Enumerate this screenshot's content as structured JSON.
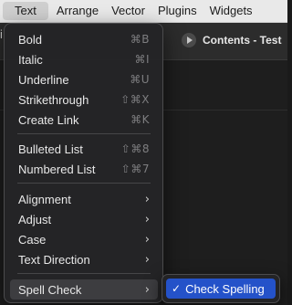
{
  "menubar": {
    "items": [
      {
        "label": "Text",
        "active": true
      },
      {
        "label": "Arrange"
      },
      {
        "label": "Vector"
      },
      {
        "label": "Plugins"
      },
      {
        "label": "Widgets"
      }
    ]
  },
  "background": {
    "left_cut_text": "i",
    "title": "Contents - Test",
    "play_icon": "play-icon"
  },
  "menu": {
    "items": [
      {
        "label": "Bold",
        "shortcut": "⌘B"
      },
      {
        "label": "Italic",
        "shortcut": "⌘I"
      },
      {
        "label": "Underline",
        "shortcut": "⌘U"
      },
      {
        "label": "Strikethrough",
        "shortcut": "⇧⌘X"
      },
      {
        "label": "Create Link",
        "shortcut": "⌘K"
      },
      {
        "label": "Bulleted List",
        "shortcut": "⇧⌘8"
      },
      {
        "label": "Numbered List",
        "shortcut": "⇧⌘7"
      },
      {
        "label": "Alignment",
        "submenu_icon": "chevron-right-icon"
      },
      {
        "label": "Adjust",
        "submenu_icon": "chevron-right-icon"
      },
      {
        "label": "Case",
        "submenu_icon": "chevron-right-icon"
      },
      {
        "label": "Text Direction",
        "submenu_icon": "chevron-right-icon"
      },
      {
        "label": "Spell Check",
        "submenu_icon": "chevron-right-icon",
        "highlighted": true
      }
    ]
  },
  "submenu": {
    "items": [
      {
        "label": "Check Spelling",
        "checked": true,
        "check_glyph": "✓"
      }
    ]
  },
  "colors": {
    "accent": "#2452c9",
    "menu_bg": "#242426",
    "menubar_bg": "#e9e9e9"
  }
}
